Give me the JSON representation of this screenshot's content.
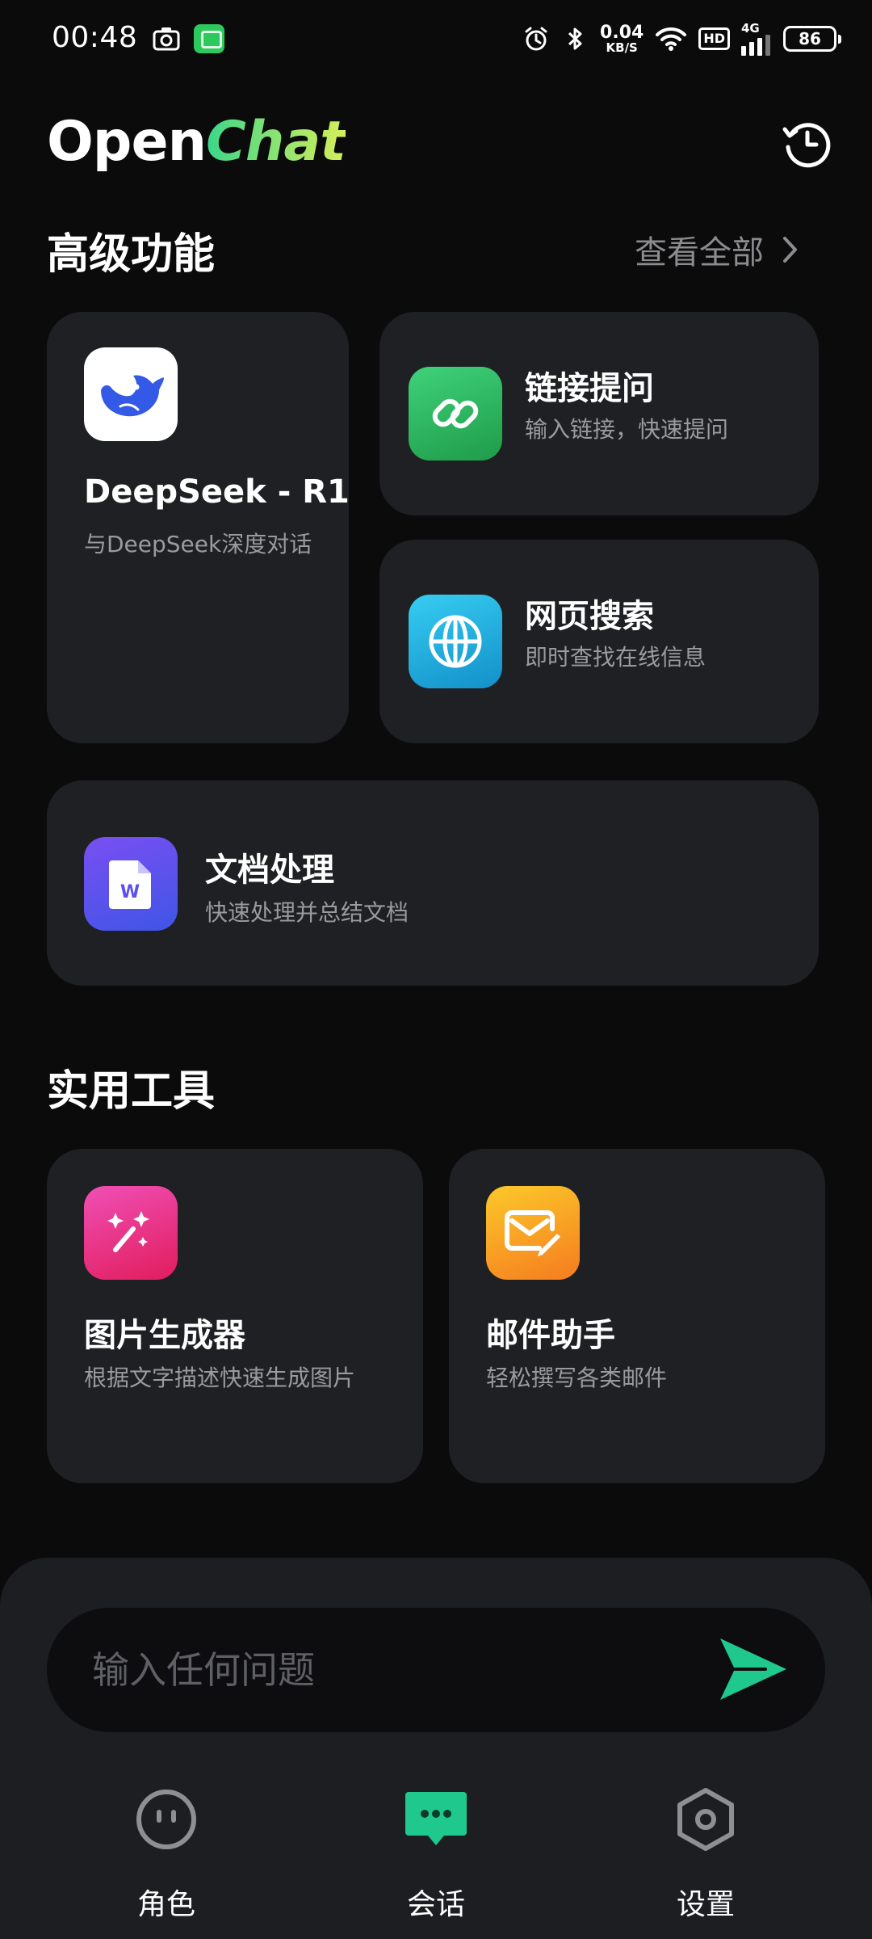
{
  "status_bar": {
    "time": "00:48",
    "speed_value": "0.04",
    "speed_unit": "KB/S",
    "hd": "HD",
    "network": "4G",
    "battery": "86"
  },
  "header": {
    "brand_part1": "Open",
    "brand_part2": "Chat",
    "history_icon": "history-clock-icon"
  },
  "advanced": {
    "title": "高级功能",
    "view_all": "查看全部",
    "cards": [
      {
        "title": "DeepSeek - R1",
        "subtitle": "与DeepSeek深度对话",
        "icon": "deepseek-whale-icon",
        "color": "#ffffff"
      },
      {
        "title": "链接提问",
        "subtitle": "输入链接，快速提问",
        "icon": "link-icon",
        "color": "#2fbf5f"
      },
      {
        "title": "网页搜索",
        "subtitle": "即时查找在线信息",
        "icon": "globe-icon",
        "color": "#1fb2e6"
      },
      {
        "title": "文档处理",
        "subtitle": "快速处理并总结文档",
        "icon": "word-document-icon",
        "color": "#5b4ff0"
      }
    ]
  },
  "tools": {
    "title": "实用工具",
    "cards": [
      {
        "title": "图片生成器",
        "subtitle": "根据文字描述快速生成图片",
        "icon": "magic-wand-icon",
        "color": "#e8337f"
      },
      {
        "title": "邮件助手",
        "subtitle": "轻松撰写各类邮件",
        "icon": "mail-edit-icon",
        "color": "#f9a11c"
      }
    ]
  },
  "composer": {
    "placeholder": "输入任何问题",
    "value": "",
    "send_icon": "send-icon",
    "accent": "#1fc98d"
  },
  "bottom_nav": {
    "items": [
      {
        "label": "角色",
        "icon": "face-icon",
        "active": false
      },
      {
        "label": "会话",
        "icon": "chat-bubble-icon",
        "active": true
      },
      {
        "label": "设置",
        "icon": "hexagon-settings-icon",
        "active": false
      }
    ]
  }
}
